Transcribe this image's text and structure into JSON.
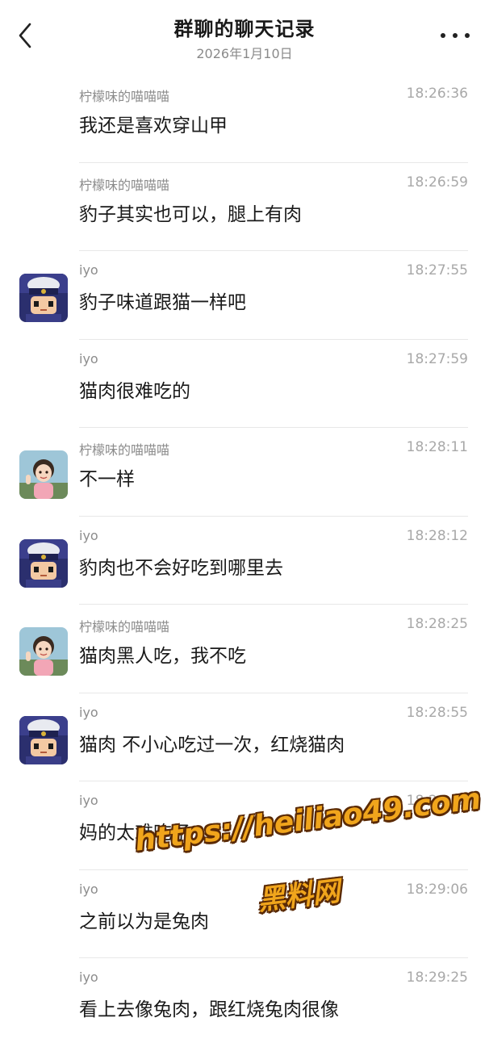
{
  "header": {
    "title": "群聊的聊天记录",
    "date": "2026年1月10日"
  },
  "messages": [
    {
      "sender": "柠檬味的喵喵喵",
      "time": "18:26:36",
      "text": "我还是喜欢穿山甲",
      "avatar": "none"
    },
    {
      "sender": "柠檬味的喵喵喵",
      "time": "18:26:59",
      "text": "豹子其实也可以，腿上有肉",
      "avatar": "none"
    },
    {
      "sender": "iyo",
      "time": "18:27:55",
      "text": "豹子味道跟猫一样吧",
      "avatar": "iyo"
    },
    {
      "sender": "iyo",
      "time": "18:27:59",
      "text": "猫肉很难吃的",
      "avatar": "none"
    },
    {
      "sender": "柠檬味的喵喵喵",
      "time": "18:28:11",
      "text": "不一样",
      "avatar": "lemon"
    },
    {
      "sender": "iyo",
      "time": "18:28:12",
      "text": "豹肉也不会好吃到哪里去",
      "avatar": "iyo"
    },
    {
      "sender": "柠檬味的喵喵喵",
      "time": "18:28:25",
      "text": "猫肉黑人吃，我不吃",
      "avatar": "lemon"
    },
    {
      "sender": "iyo",
      "time": "18:28:55",
      "text": "猫肉 不小心吃过一次，红烧猫肉",
      "avatar": "iyo"
    },
    {
      "sender": "iyo",
      "time": "18:29:02",
      "text": "妈的太难吃了",
      "avatar": "none"
    },
    {
      "sender": "iyo",
      "time": "18:29:06",
      "text": "之前以为是兔肉",
      "avatar": "none"
    },
    {
      "sender": "iyo",
      "time": "18:29:25",
      "text": "看上去像兔肉，跟红烧兔肉很像",
      "avatar": "none"
    }
  ],
  "watermark": {
    "url": "https://heiliao49.com",
    "name": "黑料网"
  }
}
